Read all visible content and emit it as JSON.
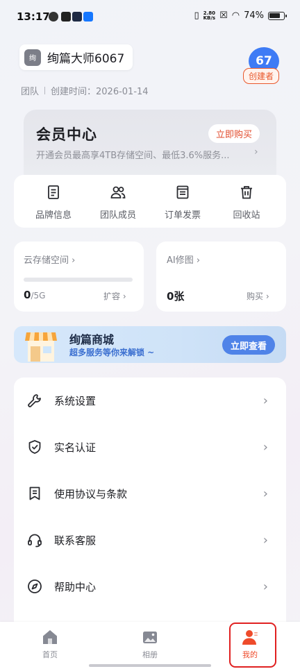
{
  "status_bar": {
    "time": "13:17",
    "net_rate_top": "2.80",
    "net_rate_bottom": "KB/s",
    "battery": "74%"
  },
  "team": {
    "avatar_text": "绚",
    "name": "绚篇大师6067",
    "member_count": "67",
    "role": "创建者",
    "type": "团队",
    "created": "创建时间：2026-01-14"
  },
  "vip": {
    "title": "会员中心",
    "subtitle": "开通会员最高享4TB存储空间、最低3.6%服务...",
    "buy_label": "立即购买"
  },
  "functions": [
    {
      "label": "品牌信息",
      "icon": "document-icon"
    },
    {
      "label": "团队成员",
      "icon": "group-icon"
    },
    {
      "label": "订单发票",
      "icon": "invoice-icon"
    },
    {
      "label": "回收站",
      "icon": "trash-icon"
    }
  ],
  "cloud_storage": {
    "title": "云存储空间 ›",
    "used": "0",
    "total": "/5G",
    "used_fraction": 0,
    "action": "扩容 ›"
  },
  "ai_retouch": {
    "title": "AI修图 ›",
    "count": "0张",
    "action": "购买 ›"
  },
  "mall": {
    "title": "绚篇商城",
    "subtitle": "超多服务等你来解锁 ~",
    "button": "立即查看"
  },
  "menu": [
    {
      "label": "系统设置",
      "icon": "wrench-icon"
    },
    {
      "label": "实名认证",
      "icon": "shield-icon"
    },
    {
      "label": "使用协议与条款",
      "icon": "bookmark-icon"
    },
    {
      "label": "联系客服",
      "icon": "headset-icon"
    },
    {
      "label": "帮助中心",
      "icon": "compass-icon"
    }
  ],
  "tabbar": [
    {
      "label": "首页",
      "icon": "home-icon",
      "active": false
    },
    {
      "label": "相册",
      "icon": "album-icon",
      "active": false
    },
    {
      "label": "我的",
      "icon": "profile-icon",
      "active": true
    }
  ],
  "colors": {
    "accent": "#3e7bf5",
    "brand_red": "#ee4b2b",
    "highlight": "#e02020"
  }
}
